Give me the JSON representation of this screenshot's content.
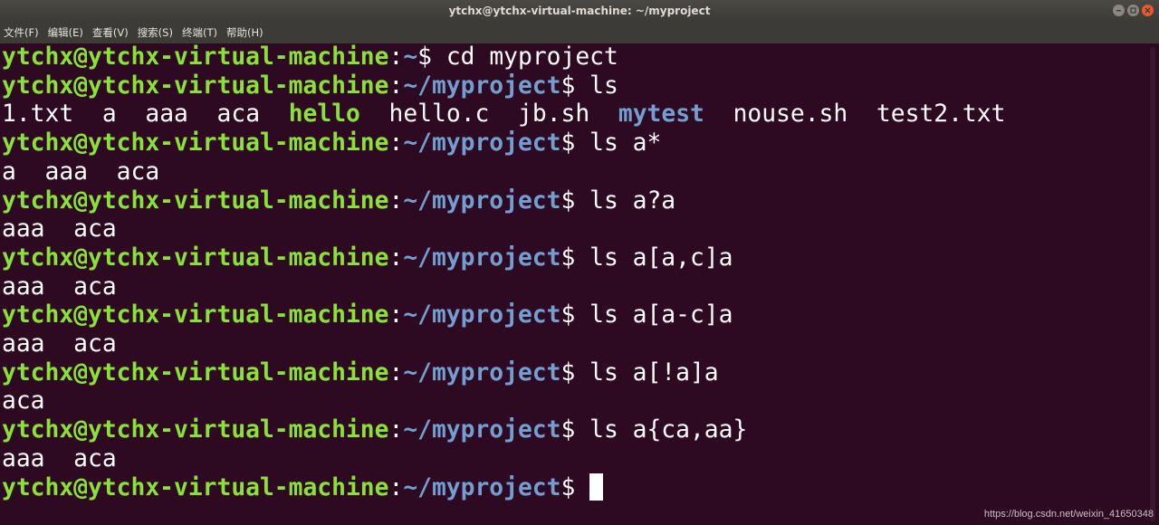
{
  "window": {
    "title": "ytchx@ytchx-virtual-machine: ~/myproject"
  },
  "menu": [
    {
      "label": "文件(F)"
    },
    {
      "label": "编辑(E)"
    },
    {
      "label": "查看(V)"
    },
    {
      "label": "搜索(S)"
    },
    {
      "label": "终端(T)"
    },
    {
      "label": "帮助(H)"
    }
  ],
  "terminal": {
    "colors": {
      "background": "#2d0922",
      "user_host": "#8ae234",
      "path": "#729fcf",
      "text": "#ffffff"
    },
    "prompt_user": "ytchx@ytchx-virtual-machine",
    "prompt_colon": ":",
    "path_home": "~",
    "path_project": "~/myproject",
    "prompt_dollar": "$",
    "lines": [
      {
        "command": " cd myproject"
      },
      {
        "command": " ls"
      },
      {
        "output": {
          "f1": "1.txt",
          "f2": "a",
          "f3": "aaa",
          "f4": "aca",
          "f5": "hello",
          "f6": "hello.c",
          "f7": "jb.sh",
          "f8": "mytest",
          "f9": "nouse.sh",
          "f10": "test2.txt"
        }
      },
      {
        "command": " ls a*"
      },
      {
        "output_text": "a  aaa  aca"
      },
      {
        "command": " ls a?a"
      },
      {
        "output_text": "aaa  aca"
      },
      {
        "command": " ls a[a,c]a"
      },
      {
        "output_text": "aaa  aca"
      },
      {
        "command": " ls a[a-c]a"
      },
      {
        "output_text": "aaa  aca"
      },
      {
        "command": " ls a[!a]a"
      },
      {
        "output_text": "aca"
      },
      {
        "command": " ls a{ca,aa}"
      },
      {
        "output_text": "aaa  aca"
      },
      {
        "command": " "
      }
    ]
  },
  "watermark": "https://blog.csdn.net/weixin_41650348"
}
